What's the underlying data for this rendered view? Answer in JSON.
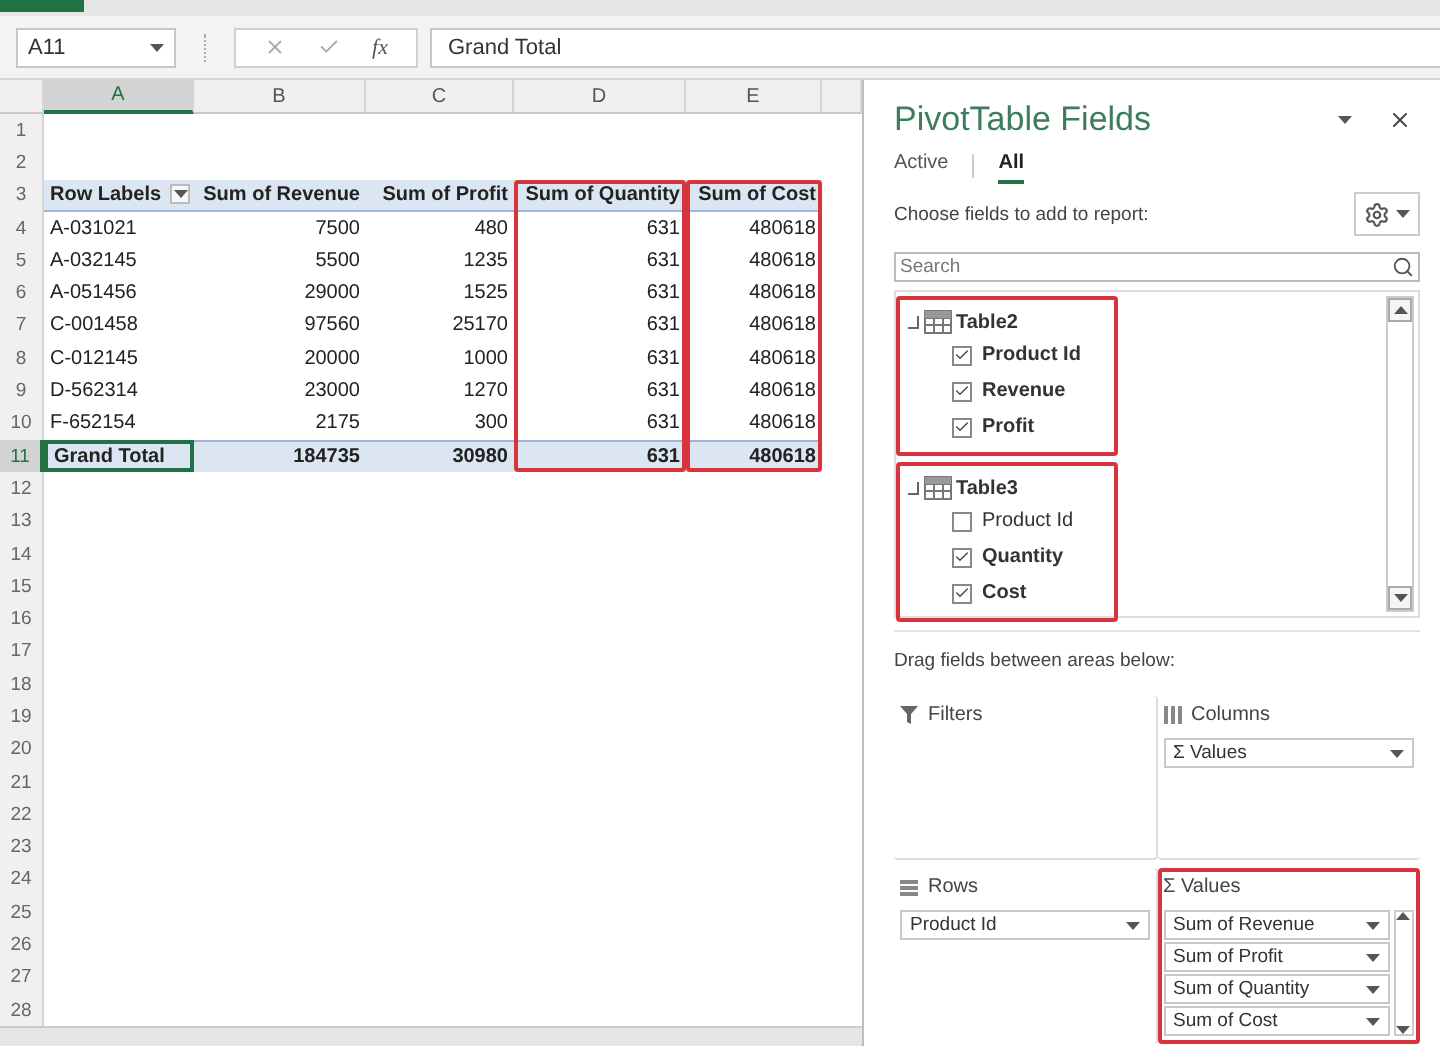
{
  "name_box": "A11",
  "formula_bar": {
    "function_label": "fx",
    "value": "Grand Total"
  },
  "sheet": {
    "columns": [
      {
        "label": "A",
        "selected": true,
        "highlighted": false
      },
      {
        "label": "B",
        "selected": false,
        "highlighted": false
      },
      {
        "label": "C",
        "selected": false,
        "highlighted": false
      },
      {
        "label": "D",
        "selected": false,
        "highlighted": true
      },
      {
        "label": "E",
        "selected": false,
        "highlighted": true
      }
    ],
    "row_numbers": [
      {
        "label": "1",
        "selected": false
      },
      {
        "label": "2",
        "selected": false
      },
      {
        "label": "3",
        "selected": false
      },
      {
        "label": "4",
        "selected": false
      },
      {
        "label": "5",
        "selected": false
      },
      {
        "label": "6",
        "selected": false
      },
      {
        "label": "7",
        "selected": false
      },
      {
        "label": "8",
        "selected": false
      },
      {
        "label": "9",
        "selected": false
      },
      {
        "label": "10",
        "selected": false
      },
      {
        "label": "11",
        "selected": true
      },
      {
        "label": "12",
        "selected": false
      },
      {
        "label": "13",
        "selected": false
      },
      {
        "label": "14",
        "selected": false
      },
      {
        "label": "15",
        "selected": false
      },
      {
        "label": "16",
        "selected": false
      },
      {
        "label": "17",
        "selected": false
      },
      {
        "label": "18",
        "selected": false
      },
      {
        "label": "19",
        "selected": false
      },
      {
        "label": "20",
        "selected": false
      },
      {
        "label": "21",
        "selected": false
      },
      {
        "label": "22",
        "selected": false
      },
      {
        "label": "23",
        "selected": false
      },
      {
        "label": "24",
        "selected": false
      },
      {
        "label": "25",
        "selected": false
      },
      {
        "label": "26",
        "selected": false
      },
      {
        "label": "27",
        "selected": false
      },
      {
        "label": "28",
        "selected": false
      }
    ]
  },
  "pivot": {
    "headers": [
      "Row Labels",
      "Sum of Revenue",
      "Sum of Profit",
      "Sum of Quantity",
      "Sum of Cost"
    ],
    "rows": [
      [
        "A-031021",
        "7500",
        "480",
        "631",
        "480618"
      ],
      [
        "A-032145",
        "5500",
        "1235",
        "631",
        "480618"
      ],
      [
        "A-051456",
        "29000",
        "1525",
        "631",
        "480618"
      ],
      [
        "C-001458",
        "97560",
        "25170",
        "631",
        "480618"
      ],
      [
        "C-012145",
        "20000",
        "1000",
        "631",
        "480618"
      ],
      [
        "D-562314",
        "23000",
        "1270",
        "631",
        "480618"
      ],
      [
        "F-652154",
        "2175",
        "300",
        "631",
        "480618"
      ]
    ],
    "total": [
      "Grand Total",
      "184735",
      "30980",
      "631",
      "480618"
    ]
  },
  "panel": {
    "title": "PivotTable Fields",
    "tabs": [
      {
        "label": "Active",
        "selected": false
      },
      {
        "label": "All",
        "selected": true
      }
    ],
    "instruction": "Choose fields to add to report:",
    "search": {
      "placeholder": "Search"
    },
    "field_groups": [
      {
        "name": "Table2",
        "highlighted": true,
        "fields": [
          {
            "label": "Product Id",
            "checked": true
          },
          {
            "label": "Revenue",
            "checked": true
          },
          {
            "label": "Profit",
            "checked": true
          }
        ]
      },
      {
        "name": "Table3",
        "highlighted": true,
        "fields": [
          {
            "label": "Product Id",
            "checked": false
          },
          {
            "label": "Quantity",
            "checked": true
          },
          {
            "label": "Cost",
            "checked": true
          }
        ]
      }
    ],
    "drag_hint": "Drag fields between areas below:",
    "areas": [
      {
        "kind": "filters",
        "label": "Filters",
        "highlighted": false
      },
      {
        "kind": "columns",
        "label": "Columns",
        "highlighted": false,
        "items": [
          "Σ Values"
        ]
      },
      {
        "kind": "rows",
        "label": "Rows",
        "highlighted": false,
        "items": [
          "Product Id"
        ]
      },
      {
        "kind": "values",
        "label": "Σ Values",
        "highlighted": true,
        "items": [
          "Sum of Revenue",
          "Sum of Profit",
          "Sum of Quantity",
          "Sum of Cost"
        ]
      }
    ]
  }
}
